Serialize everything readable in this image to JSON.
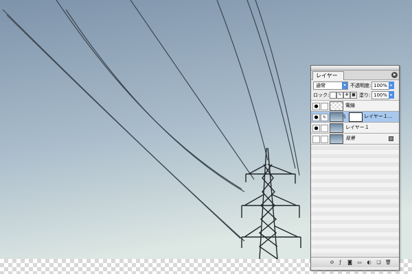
{
  "palette": {
    "tab_label": "レイヤー",
    "blend_mode": "通常",
    "opacity_label": "不透明度:",
    "opacity_value": "100%",
    "lock_label": "ロック:",
    "fill_label": "塗り:",
    "fill_value": "100%",
    "layers": [
      {
        "name": "電線"
      },
      {
        "name": "レイヤー１..."
      },
      {
        "name": "レイヤー１"
      },
      {
        "name": "背景"
      }
    ]
  },
  "colors": {
    "sky_top": "#7d93aa",
    "sky_bottom": "#dde7e3",
    "selection": "#a8c8ee",
    "accent": "#4f8fe0"
  }
}
